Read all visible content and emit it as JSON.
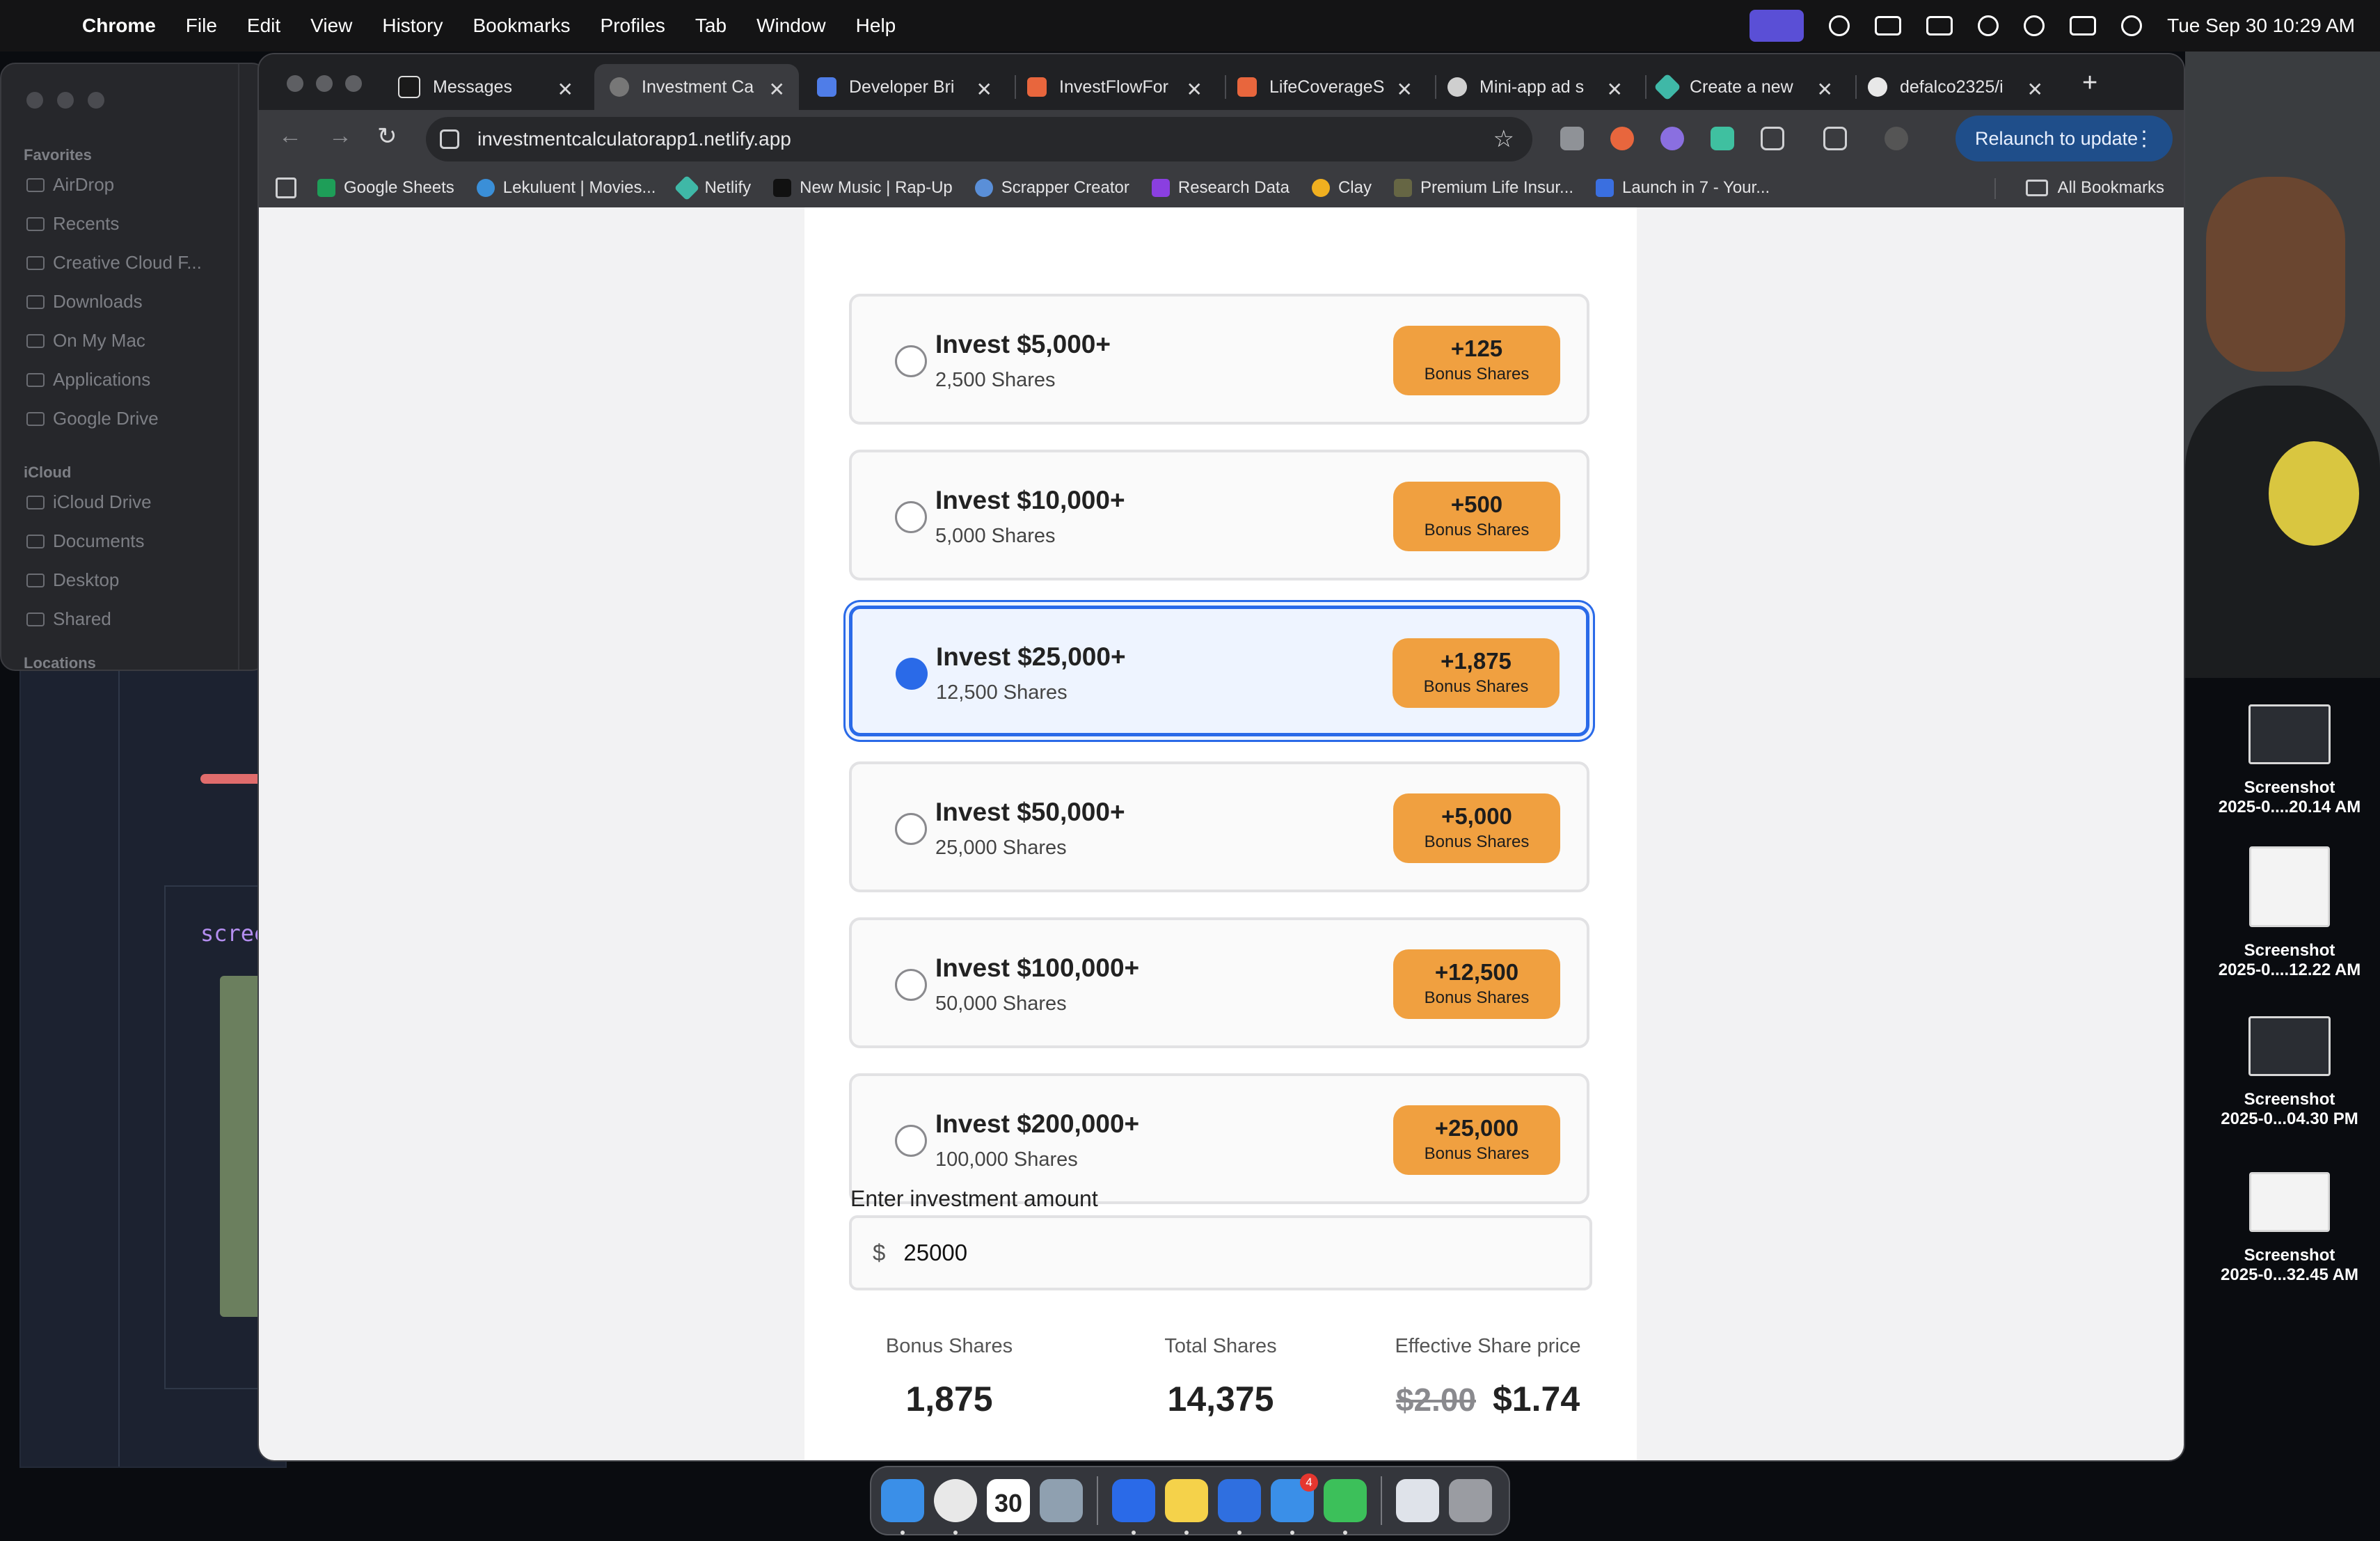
{
  "menubar": {
    "app_name": "Chrome",
    "items": [
      "File",
      "Edit",
      "View",
      "History",
      "Bookmarks",
      "Profiles",
      "Tab",
      "Window",
      "Help"
    ],
    "datetime": "Tue Sep 30  10:29 AM"
  },
  "finder": {
    "favorites_label": "Favorites",
    "favorites": [
      "AirDrop",
      "Recents",
      "Creative Cloud F...",
      "Downloads",
      "On My Mac",
      "Applications",
      "Google Drive"
    ],
    "icloud_label": "iCloud",
    "icloud": [
      "iCloud Drive",
      "Documents",
      "Desktop",
      "Shared"
    ],
    "locations_label": "Locations"
  },
  "background_editor": {
    "partial_text": "scree"
  },
  "desktop_files": [
    {
      "name": "Screenshot",
      "date": "2025-0....20.14 AM"
    },
    {
      "name": "Screenshot",
      "date": "2025-0....12.22 AM"
    },
    {
      "name": "Screenshot",
      "date": "2025-0...04.30 PM"
    },
    {
      "name": "Screenshot",
      "date": "2025-0...32.45 AM"
    }
  ],
  "browser": {
    "tabs": [
      {
        "label": "Messages",
        "icon": "upwork-icon",
        "color": "#1a1a1a"
      },
      {
        "label": "Investment Ca",
        "icon": "globe-icon",
        "color": "#777777",
        "active": true
      },
      {
        "label": "Developer Bri",
        "icon": "docs-icon",
        "color": "#4f7de8"
      },
      {
        "label": "InvestFlowFor",
        "icon": "n8n-icon",
        "color": "#e8663d"
      },
      {
        "label": "LifeCoverageS",
        "icon": "n8n-icon",
        "color": "#e8663d"
      },
      {
        "label": "Mini-app ad s",
        "icon": "openai-icon",
        "color": "#cfcfcf"
      },
      {
        "label": "Create a new",
        "icon": "netlify-icon",
        "color": "#3fb8a7"
      },
      {
        "label": "defalco2325/i",
        "icon": "github-icon",
        "color": "#e8e8e8"
      }
    ],
    "url": "investmentcalculatorapp1.netlify.app",
    "relaunch_label": "Relaunch to update",
    "bookmarks": [
      {
        "label": "Google Sheets",
        "color": "#1e9e58"
      },
      {
        "label": "Lekuluent | Movies...",
        "color": "#3a8fd8"
      },
      {
        "label": "Netlify",
        "color": "#3fb8a7"
      },
      {
        "label": "New Music | Rap-Up",
        "color": "#111111"
      },
      {
        "label": "Scrapper Creator",
        "color": "#5a8fd8"
      },
      {
        "label": "Research Data",
        "color": "#8a3fe0"
      },
      {
        "label": "Clay",
        "color": "#f0b020"
      },
      {
        "label": "Premium Life Insur...",
        "color": "#666644"
      },
      {
        "label": "Launch in 7 - Your...",
        "color": "#3a6fe0"
      }
    ],
    "all_bookmarks_label": "All Bookmarks"
  },
  "calculator": {
    "tiers": [
      {
        "title": "Invest $5,000+",
        "shares": "2,500 Shares",
        "bonus": "+125",
        "bonus_label": "Bonus Shares",
        "selected": false
      },
      {
        "title": "Invest $10,000+",
        "shares": "5,000 Shares",
        "bonus": "+500",
        "bonus_label": "Bonus Shares",
        "selected": false
      },
      {
        "title": "Invest $25,000+",
        "shares": "12,500 Shares",
        "bonus": "+1,875",
        "bonus_label": "Bonus Shares",
        "selected": true
      },
      {
        "title": "Invest $50,000+",
        "shares": "25,000 Shares",
        "bonus": "+5,000",
        "bonus_label": "Bonus Shares",
        "selected": false
      },
      {
        "title": "Invest $100,000+",
        "shares": "50,000 Shares",
        "bonus": "+12,500",
        "bonus_label": "Bonus Shares",
        "selected": false
      },
      {
        "title": "Invest $200,000+",
        "shares": "100,000 Shares",
        "bonus": "+25,000",
        "bonus_label": "Bonus Shares",
        "selected": false
      }
    ],
    "amount_label": "Enter investment amount",
    "currency_symbol": "$",
    "amount_value": "25000",
    "stats": {
      "bonus_label": "Bonus Shares",
      "bonus_value": "1,875",
      "total_label": "Total Shares",
      "total_value": "14,375",
      "price_label": "Effective Share price",
      "old_price": "$2.00",
      "new_price": "$1.74"
    },
    "accent_color": "#2a6ae8",
    "badge_color": "#f0a040"
  },
  "dock": {
    "calendar_day": "30",
    "mail_badge": "4"
  }
}
